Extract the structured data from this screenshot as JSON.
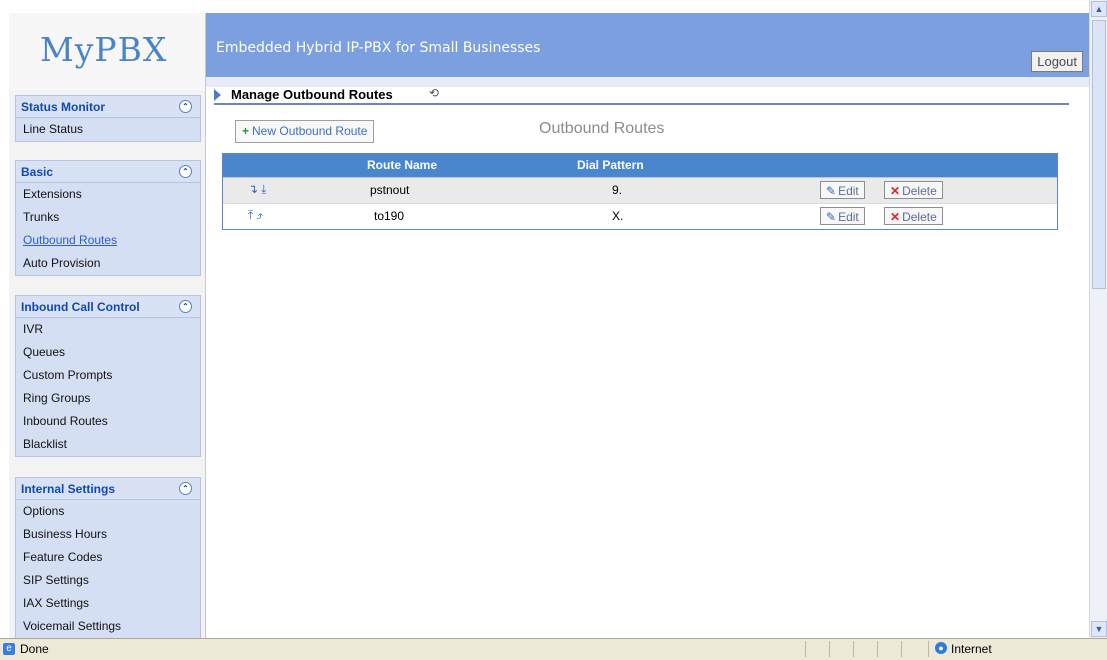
{
  "brand": {
    "logo": "MyPBX",
    "tagline": "Embedded Hybrid IP-PBX for Small Businesses"
  },
  "header": {
    "logout_label": "Logout"
  },
  "sidebar": {
    "sections": [
      {
        "title": "Status Monitor",
        "items": [
          "Line Status"
        ]
      },
      {
        "title": "Basic",
        "items": [
          "Extensions",
          "Trunks",
          "Outbound Routes",
          "Auto Provision"
        ],
        "active": "Outbound Routes"
      },
      {
        "title": "Inbound Call Control",
        "items": [
          "IVR",
          "Queues",
          "Custom Prompts",
          "Ring Groups",
          "Inbound Routes",
          "Blacklist"
        ]
      },
      {
        "title": "Internal Settings",
        "items": [
          "Options",
          "Business Hours",
          "Feature Codes",
          "SIP Settings",
          "IAX Settings",
          "Voicemail Settings"
        ]
      }
    ]
  },
  "main": {
    "breadcrumb": "Manage Outbound Routes",
    "new_button": "New Outbound Route",
    "section_title": "Outbound Routes",
    "table": {
      "headers": [
        "Route Name",
        "Dial Pattern"
      ],
      "rows": [
        {
          "route_name": "pstnout",
          "dial_pattern": "9.",
          "edit": "Edit",
          "delete": "Delete"
        },
        {
          "route_name": "to190",
          "dial_pattern": "X.",
          "edit": "Edit",
          "delete": "Delete"
        }
      ]
    }
  },
  "statusbar": {
    "status": "Done",
    "zone": "Internet"
  },
  "colors": {
    "header": "#7c9fe0",
    "table_header": "#4a86ce",
    "accent": "#1149ad"
  },
  "icons": [
    "refresh-icon",
    "plus-icon",
    "edit-icon",
    "delete-icon",
    "move-down-icon",
    "move-bottom-icon",
    "move-top-icon",
    "move-up-icon",
    "ie-page-icon",
    "internet-globe-icon",
    "collapse-icon"
  ]
}
